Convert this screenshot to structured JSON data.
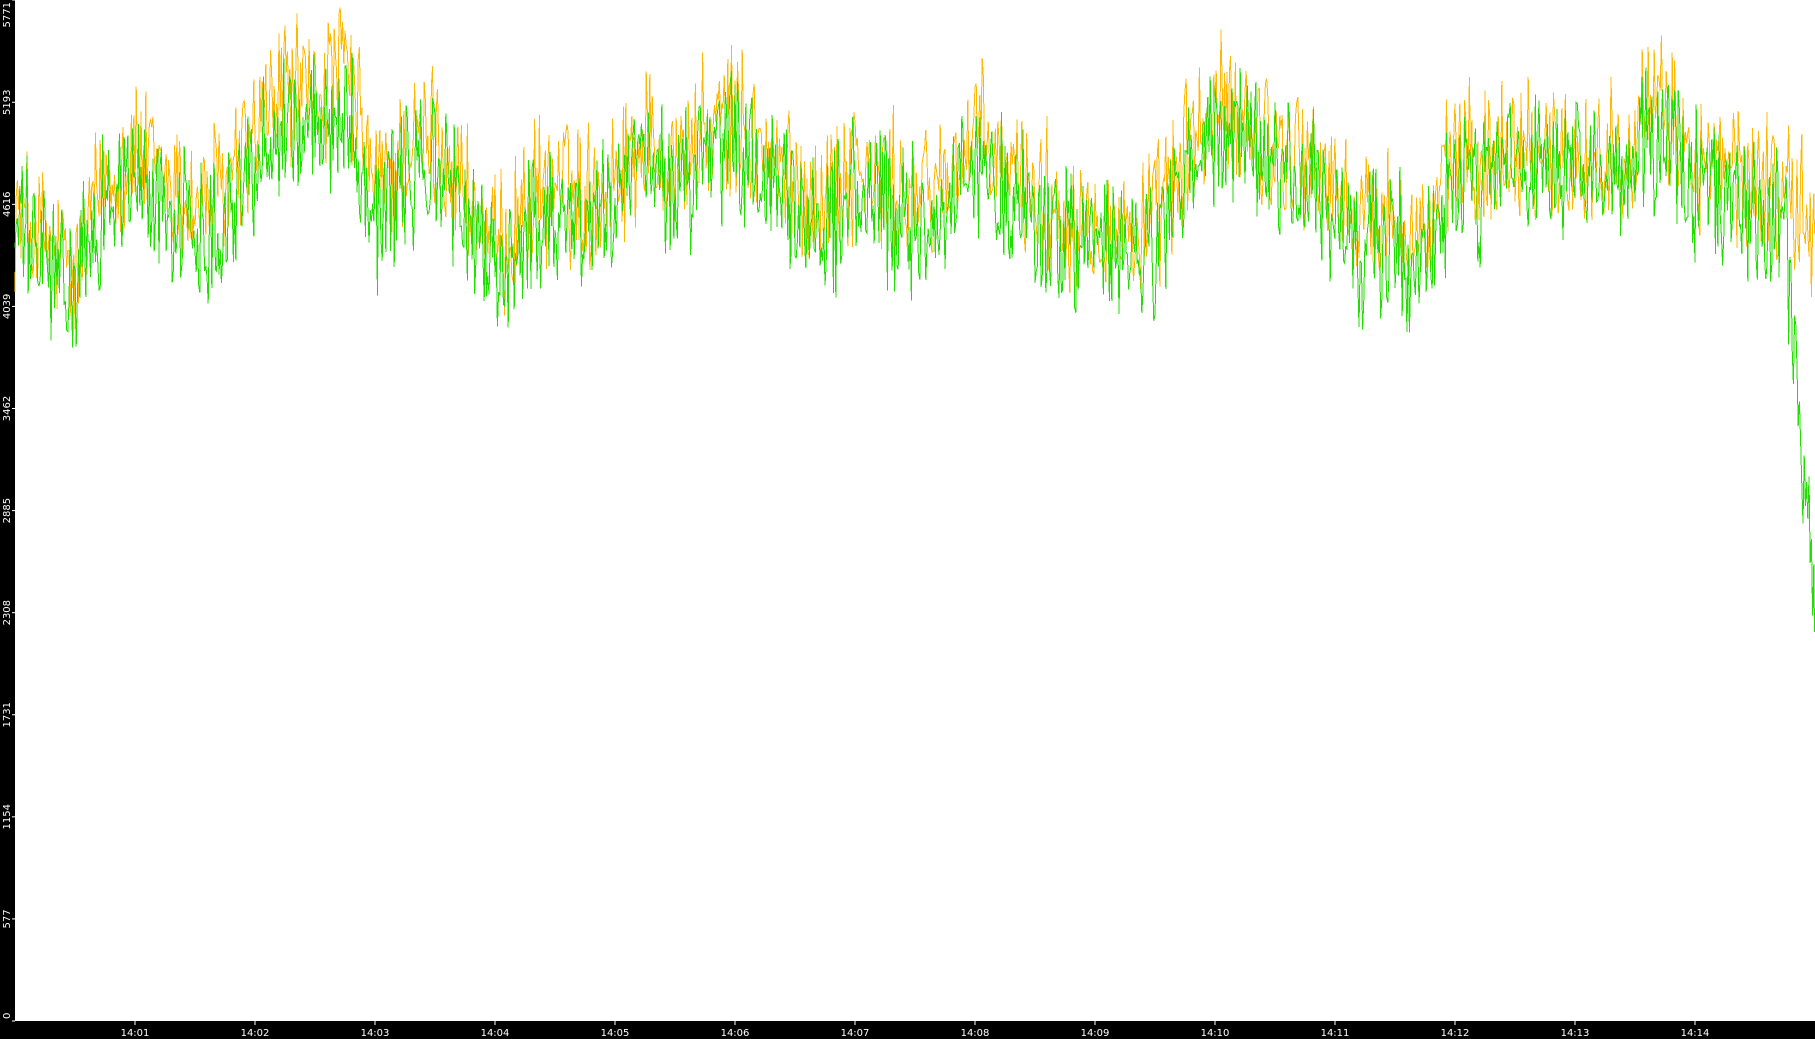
{
  "chart_data": {
    "type": "line",
    "title": "",
    "xlabel": "",
    "ylabel": "",
    "grid": false,
    "legend": "none",
    "background_color": "#000000",
    "plot_color": "#ffffff",
    "ylim": [
      0,
      5771
    ],
    "y_ticks": [
      "0",
      "577",
      "1154",
      "1731",
      "2308",
      "2885",
      "3462",
      "4039",
      "4616",
      "5193",
      "5771"
    ],
    "x_range": [
      "14:00:00",
      "14:15:00"
    ],
    "x_ticks": [
      "14:01",
      "14:02",
      "14:03",
      "14:04",
      "14:05",
      "14:06",
      "14:07",
      "14:08",
      "14:09",
      "14:10",
      "14:11",
      "14:12",
      "14:13",
      "14:14"
    ],
    "series": [
      {
        "color": "#ffb800",
        "x": [
          "14:00:00",
          "14:00:15",
          "14:00:30",
          "14:00:45",
          "14:01:00",
          "14:01:15",
          "14:01:30",
          "14:01:45",
          "14:02:00",
          "14:02:15",
          "14:02:30",
          "14:02:45",
          "14:03:00",
          "14:03:15",
          "14:03:30",
          "14:03:45",
          "14:04:00",
          "14:04:15",
          "14:04:30",
          "14:04:45",
          "14:05:00",
          "14:05:15",
          "14:05:30",
          "14:05:45",
          "14:06:00",
          "14:06:15",
          "14:06:30",
          "14:06:45",
          "14:07:00",
          "14:07:15",
          "14:07:30",
          "14:07:45",
          "14:08:00",
          "14:08:15",
          "14:08:30",
          "14:08:45",
          "14:09:00",
          "14:09:15",
          "14:09:30",
          "14:09:45",
          "14:10:00",
          "14:10:15",
          "14:10:30",
          "14:10:45",
          "14:11:00",
          "14:11:15",
          "14:11:30",
          "14:11:45",
          "14:12:00",
          "14:12:15",
          "14:12:30",
          "14:12:45",
          "14:13:00",
          "14:13:15",
          "14:13:30",
          "14:13:45",
          "14:14:00",
          "14:14:15",
          "14:14:30",
          "14:14:45",
          "14:15:00"
        ],
        "values": [
          4600,
          4400,
          4200,
          4800,
          4900,
          4750,
          4600,
          4700,
          5000,
          5300,
          5200,
          5400,
          4700,
          4900,
          5000,
          4700,
          4300,
          4600,
          4750,
          4650,
          4800,
          5000,
          4850,
          5000,
          5100,
          4900,
          4700,
          4650,
          4850,
          4700,
          4650,
          4750,
          5000,
          4800,
          4700,
          4550,
          4550,
          4450,
          4500,
          4900,
          5150,
          5100,
          4950,
          4900,
          4650,
          4500,
          4550,
          4400,
          4900,
          4850,
          5000,
          4900,
          4900,
          4850,
          5050,
          5150,
          4850,
          4800,
          4750,
          4700,
          4450
        ]
      },
      {
        "color": "#22dd00",
        "x": [
          "14:00:00",
          "14:00:15",
          "14:00:30",
          "14:00:45",
          "14:01:00",
          "14:01:15",
          "14:01:30",
          "14:01:45",
          "14:02:00",
          "14:02:15",
          "14:02:30",
          "14:02:45",
          "14:03:00",
          "14:03:15",
          "14:03:30",
          "14:03:45",
          "14:04:00",
          "14:04:15",
          "14:04:30",
          "14:04:45",
          "14:05:00",
          "14:05:15",
          "14:05:30",
          "14:05:45",
          "14:06:00",
          "14:06:15",
          "14:06:30",
          "14:06:45",
          "14:07:00",
          "14:07:15",
          "14:07:30",
          "14:07:45",
          "14:08:00",
          "14:08:15",
          "14:08:30",
          "14:08:45",
          "14:09:00",
          "14:09:15",
          "14:09:30",
          "14:09:45",
          "14:10:00",
          "14:10:15",
          "14:10:30",
          "14:10:45",
          "14:11:00",
          "14:11:15",
          "14:11:30",
          "14:11:45",
          "14:12:00",
          "14:12:15",
          "14:12:30",
          "14:12:45",
          "14:13:00",
          "14:13:15",
          "14:13:30",
          "14:13:45",
          "14:14:00",
          "14:14:15",
          "14:14:30",
          "14:14:45",
          "14:15:00"
        ],
        "values": [
          4500,
          4300,
          4100,
          4650,
          4750,
          4600,
          4450,
          4550,
          4850,
          5100,
          5000,
          5200,
          4550,
          4750,
          4850,
          4550,
          4200,
          4450,
          4600,
          4500,
          4650,
          4850,
          4700,
          4850,
          4950,
          4750,
          4550,
          4500,
          4700,
          4550,
          4500,
          4600,
          4850,
          4650,
          4550,
          4400,
          4400,
          4300,
          4350,
          4750,
          5000,
          4950,
          4800,
          4750,
          4500,
          4350,
          4400,
          4250,
          4750,
          4700,
          4850,
          4750,
          4750,
          4700,
          4900,
          5000,
          4700,
          4650,
          4600,
          4550,
          2200
        ]
      }
    ]
  }
}
